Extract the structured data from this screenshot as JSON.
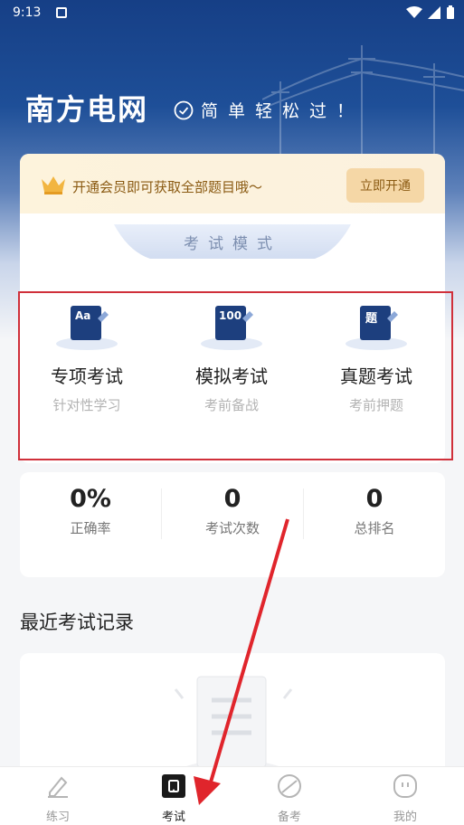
{
  "status_bar": {
    "time": "9:13"
  },
  "header": {
    "brand": "南方电网",
    "slogan": "简单轻松过！"
  },
  "vip_banner": {
    "text": "开通会员即可获取全部题目哦～",
    "button_label": "立即开通",
    "accent": "#f5d7a6"
  },
  "mode_section": {
    "title": "考试模式"
  },
  "modes": [
    {
      "name": "专项考试",
      "sub": "针对性学习",
      "icon_text": "Aa",
      "icon": "aa-book-icon"
    },
    {
      "name": "模拟考试",
      "sub": "考前备战",
      "icon_text": "100",
      "icon": "score-book-icon"
    },
    {
      "name": "真题考试",
      "sub": "考前押题",
      "icon_text": "题",
      "icon": "question-book-icon"
    }
  ],
  "stats": [
    {
      "value": "0%",
      "label": "正确率"
    },
    {
      "value": "0",
      "label": "考试次数"
    },
    {
      "value": "0",
      "label": "总排名"
    }
  ],
  "recent": {
    "title": "最近考试记录"
  },
  "tabs": [
    {
      "label": "练习",
      "icon": "pencil-icon"
    },
    {
      "label": "考试",
      "icon": "exam-icon"
    },
    {
      "label": "备考",
      "icon": "compass-icon"
    },
    {
      "label": "我的",
      "icon": "profile-icon"
    }
  ],
  "colors": {
    "brand_blue": "#163f86",
    "highlight_red": "#d0303a",
    "icon_navy": "#1d3f7e"
  }
}
